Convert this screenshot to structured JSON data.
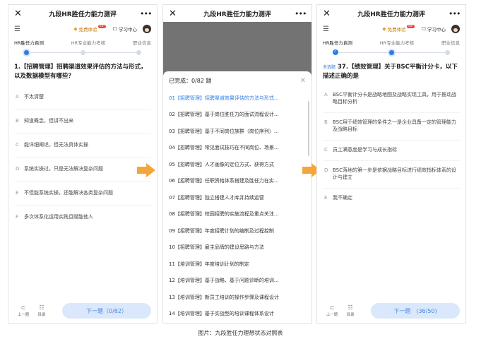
{
  "screens": {
    "s1": {
      "title": "九段HR胜任力能力测评",
      "trial": "免费体验",
      "vip": "VIP",
      "study": "学习中心",
      "tabs": [
        "HR胜任力自测",
        "HR专业能力考核",
        "职业信息"
      ],
      "question": "1.【招聘管理】招聘渠道效果评估的方法与形式，以及数据模型有哪些？",
      "options": [
        {
          "letter": "A",
          "text": "不太清楚"
        },
        {
          "letter": "B",
          "text": "知道概念，但讲不出来"
        },
        {
          "letter": "C",
          "text": "能详细阐述，但无法具体实操"
        },
        {
          "letter": "D",
          "text": "系统实操过，只是无法解决复杂问题"
        },
        {
          "letter": "E",
          "text": "不但能系统实操，还能解决各类复杂问题"
        },
        {
          "letter": "F",
          "text": "多次体系化运用实践且赋能他人"
        }
      ],
      "prev": "上一题",
      "catalog": "目录",
      "next": "下一题（0/82）"
    },
    "s2": {
      "title": "九段HR胜任力能力测评",
      "completed": "已完成：0/82 题",
      "items": [
        "01【招聘管理】招聘渠道效果评估的方法与形式...",
        "02【招聘管理】基于岗位胜任力的面试流程设计...",
        "03【招聘管理】基于不同岗位族群（岗位序列）...",
        "04【招聘管理】常见面试技巧在不同岗位、场景...",
        "05【招聘管理】人才画像的定位方式、获得方式",
        "06【招聘管理】任职资格体系搭建及胜任力在实...",
        "07【招聘管理】独立搭建人才库并持续运营",
        "08【招聘管理】校园招聘的实施流程及重点关注...",
        "09【招聘管理】年度招聘计划的编制及过程控制",
        "10【招聘管理】雇主品牌的建设思路与方法",
        "11【培训管理】年度培训计划的制定",
        "12【培训管理】基于战略、基于问题诊断的培训...",
        "13【培训管理】新员工培训的操作步骤及课程设计",
        "14【培训管理】基于实战型的培训课程体系设计"
      ]
    },
    "s3": {
      "title": "九段HR胜任力能力测评",
      "trial": "免费体验",
      "vip": "VIP",
      "study": "学习中心",
      "tabs": [
        "HR胜任力自测",
        "HR专业能力考核",
        "职业信息"
      ],
      "tag": "多选题",
      "question": "37.【绩效管理】关于BSC平衡计分卡，以下描述正确的是",
      "options": [
        {
          "letter": "A",
          "text": "BSC平衡计分卡是战略地图及战略实现工具，用于推动战略目标分析"
        },
        {
          "letter": "B",
          "text": "BSC用于绩效管理的条件之一是企业具备一定的管理能力及战略目标"
        },
        {
          "letter": "C",
          "text": "员工满意度是学习与成长指标"
        },
        {
          "letter": "D",
          "text": "BSC落地的第一步是依据战略目标进行绩效指标体系的设计与建立"
        },
        {
          "letter": "E",
          "text": "我不确定"
        }
      ],
      "prev": "上一题",
      "catalog": "目录",
      "next": "下一题　(36/50)"
    }
  },
  "caption": "图片：九段胜任力理想状态对照表",
  "colors": {
    "accent": "#2e7be6",
    "arrow": "#f5a53c",
    "button_bg": "#dbe8fb"
  }
}
